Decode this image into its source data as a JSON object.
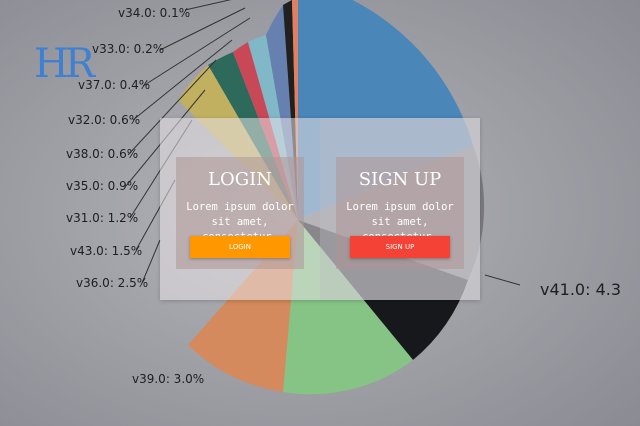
{
  "logo": {
    "text": "HR",
    "color": "#3f80d0"
  },
  "background_chart": {
    "labels": [
      "v34.0: 0.1%",
      "v33.0: 0.2%",
      "v37.0: 0.4%",
      "v32.0: 0.6%",
      "v38.0: 0.6%",
      "v35.0: 0.9%",
      "v31.0: 1.2%",
      "v43.0: 1.5%",
      "v36.0: 2.5%",
      "v39.0: 3.0%",
      "v41.0: 4.3"
    ]
  },
  "login": {
    "title": "LOGIN",
    "text": "Lorem ipsum dolor sit amet, consectetur.",
    "button_label": "LOGIN",
    "button_color": "#ff9800"
  },
  "signup": {
    "title": "SIGN UP",
    "text": "Lorem ipsum dolor sit amet, consectetur.",
    "button_label": "SIGN UP",
    "button_color": "#f44336"
  }
}
